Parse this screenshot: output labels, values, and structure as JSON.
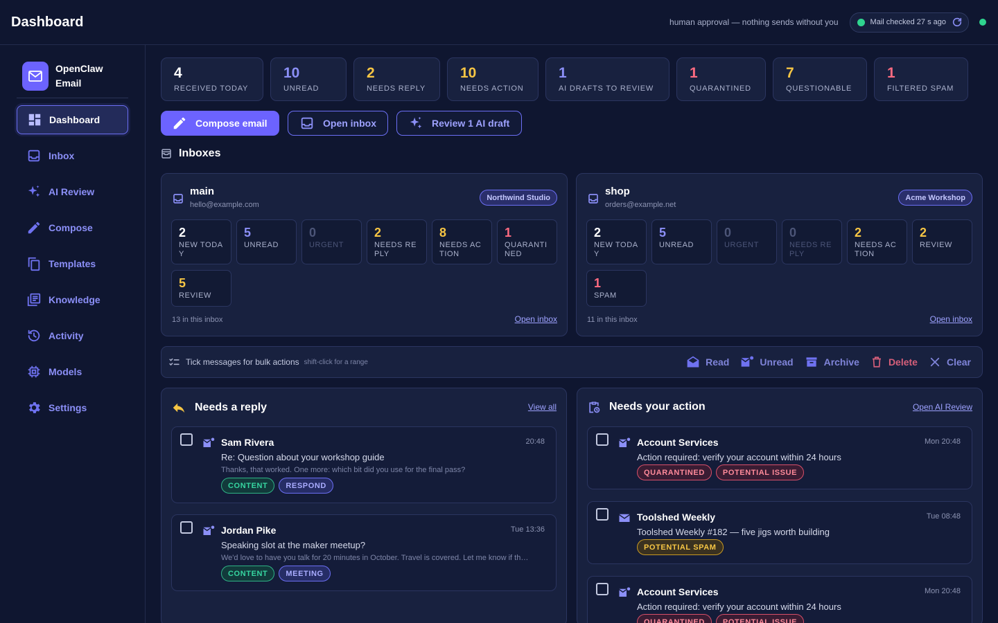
{
  "header": {
    "title": "Dashboard",
    "tagline": "human approval — nothing sends without you",
    "mail_status": "Mail checked 27 s ago"
  },
  "brand": {
    "name": "OpenClaw Email"
  },
  "nav": [
    {
      "label": "Dashboard",
      "icon": "dashboard-icon",
      "active": true
    },
    {
      "label": "Inbox",
      "icon": "inbox-icon"
    },
    {
      "label": "AI Review",
      "icon": "sparkles-icon"
    },
    {
      "label": "Compose",
      "icon": "pencil-icon"
    },
    {
      "label": "Templates",
      "icon": "copy-icon"
    },
    {
      "label": "Knowledge",
      "icon": "library-icon"
    },
    {
      "label": "Activity",
      "icon": "history-icon"
    },
    {
      "label": "Models",
      "icon": "chip-icon"
    },
    {
      "label": "Settings",
      "icon": "gear-icon"
    }
  ],
  "stats": [
    {
      "value": "4",
      "label": "RECEIVED TODAY",
      "color": "#ffffff"
    },
    {
      "value": "10",
      "label": "UNREAD",
      "color": "#8b8ff7"
    },
    {
      "value": "2",
      "label": "NEEDS REPLY",
      "color": "#f6c544"
    },
    {
      "value": "10",
      "label": "NEEDS ACTION",
      "color": "#f6c544"
    },
    {
      "value": "1",
      "label": "AI DRAFTS TO REVIEW",
      "color": "#8b8ff7"
    },
    {
      "value": "1",
      "label": "QUARANTINED",
      "color": "#ff6b81"
    },
    {
      "value": "7",
      "label": "QUESTIONABLE",
      "color": "#f6c544"
    },
    {
      "value": "1",
      "label": "FILTERED SPAM",
      "color": "#ff6b81"
    }
  ],
  "actions": {
    "compose": "Compose email",
    "open_inbox": "Open inbox",
    "review": "Review 1 AI draft"
  },
  "inboxes_title": "Inboxes",
  "inboxes": [
    {
      "name": "main",
      "email": "hello@example.com",
      "org": "Northwind Studio",
      "count": "13 in this inbox",
      "open": "Open inbox",
      "stats": [
        {
          "value": "2",
          "label": "NEW TODAY",
          "color": "#ffffff"
        },
        {
          "value": "5",
          "label": "UNREAD",
          "color": "#8b8ff7"
        },
        {
          "value": "0",
          "label": "URGENT",
          "dim": true
        },
        {
          "value": "2",
          "label": "NEEDS REPLY",
          "color": "#f6c544"
        },
        {
          "value": "8",
          "label": "NEEDS ACTION",
          "color": "#f6c544"
        },
        {
          "value": "1",
          "label": "QUARANTINED",
          "color": "#ff6b81"
        },
        {
          "value": "5",
          "label": "REVIEW",
          "color": "#f6c544"
        }
      ]
    },
    {
      "name": "shop",
      "email": "orders@example.net",
      "org": "Acme Workshop",
      "count": "11 in this inbox",
      "open": "Open inbox",
      "stats": [
        {
          "value": "2",
          "label": "NEW TODAY",
          "color": "#ffffff"
        },
        {
          "value": "5",
          "label": "UNREAD",
          "color": "#8b8ff7"
        },
        {
          "value": "0",
          "label": "URGENT",
          "dim": true
        },
        {
          "value": "0",
          "label": "NEEDS REPLY",
          "dim": true
        },
        {
          "value": "2",
          "label": "NEEDS ACTION",
          "color": "#f6c544"
        },
        {
          "value": "2",
          "label": "REVIEW",
          "color": "#f6c544"
        },
        {
          "value": "1",
          "label": "SPAM",
          "color": "#ff6b81"
        }
      ]
    }
  ],
  "bulk": {
    "text": "Tick messages for bulk actions",
    "hint": "shift-click for a range",
    "read": "Read",
    "unread": "Unread",
    "archive": "Archive",
    "delete": "Delete",
    "clear": "Clear"
  },
  "reply_panel": {
    "title": "Needs a reply",
    "link": "View all",
    "messages": [
      {
        "from": "Sam Rivera",
        "time": "20:48",
        "subject": "Re: Question about your workshop guide",
        "preview": "Thanks, that worked. One more: which bit did you use for the final pass?",
        "tags": [
          {
            "label": "CONTENT",
            "kind": "content"
          },
          {
            "label": "RESPOND",
            "kind": "respond"
          }
        ]
      },
      {
        "from": "Jordan Pike",
        "time": "Tue 13:36",
        "subject": "Speaking slot at the maker meetup?",
        "preview": "We'd love to have you talk for 20 minutes in October. Travel is covered. Let me know if th…",
        "tags": [
          {
            "label": "CONTENT",
            "kind": "content"
          },
          {
            "label": "MEETING",
            "kind": "meeting"
          }
        ]
      }
    ]
  },
  "action_panel": {
    "title": "Needs your action",
    "link": "Open AI Review",
    "messages": [
      {
        "from": "Account Services",
        "time": "Mon 20:48",
        "subject": "Action required: verify your account within 24 hours",
        "tags": [
          {
            "label": "QUARANTINED",
            "kind": "quar"
          },
          {
            "label": "POTENTIAL ISSUE",
            "kind": "issue"
          }
        ]
      },
      {
        "from": "Toolshed Weekly",
        "time": "Tue 08:48",
        "subject": "Toolshed Weekly #182 — five jigs worth building",
        "tags": [
          {
            "label": "POTENTIAL SPAM",
            "kind": "spam"
          }
        ]
      },
      {
        "from": "Account Services",
        "time": "Mon 20:48",
        "subject": "Action required: verify your account within 24 hours",
        "tags": [
          {
            "label": "QUARANTINED",
            "kind": "quar"
          },
          {
            "label": "POTENTIAL ISSUE",
            "kind": "issue"
          }
        ]
      }
    ]
  }
}
